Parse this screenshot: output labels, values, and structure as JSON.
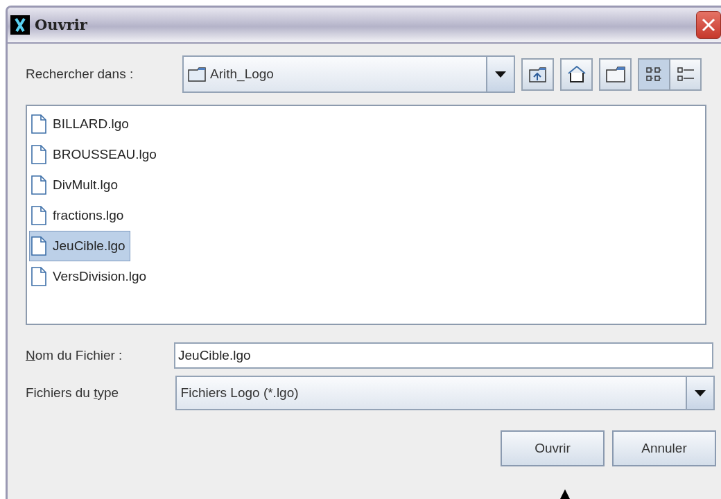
{
  "window": {
    "title": "Ouvrir"
  },
  "look_in": {
    "label": "Rechercher dans :",
    "value": "Arith_Logo"
  },
  "actions": [
    {
      "kind": "up"
    },
    {
      "kind": "home"
    },
    {
      "kind": "new-folder"
    }
  ],
  "views": [
    {
      "kind": "list",
      "selected": true
    },
    {
      "kind": "details",
      "selected": false
    }
  ],
  "files": [
    {
      "name": "BILLARD.lgo",
      "selected": false
    },
    {
      "name": "BROUSSEAU.lgo",
      "selected": false
    },
    {
      "name": "DivMult.lgo",
      "selected": false
    },
    {
      "name": "fractions.lgo",
      "selected": false
    },
    {
      "name": "JeuCible.lgo",
      "selected": true
    },
    {
      "name": "VersDivision.lgo",
      "selected": false
    }
  ],
  "file_name": {
    "label": [
      {
        "text": "N",
        "underlined": true
      },
      {
        "text": "om du Fichier :",
        "underlined": false
      }
    ],
    "value": "JeuCible.lgo"
  },
  "file_type": {
    "label": [
      {
        "text": "Fichiers du ",
        "underlined": false
      },
      {
        "text": "t",
        "underlined": true
      },
      {
        "text": "ype",
        "underlined": false
      }
    ],
    "value": "Fichiers Logo (*.lgo)"
  },
  "buttons": [
    "Ouvrir",
    "Annuler"
  ]
}
